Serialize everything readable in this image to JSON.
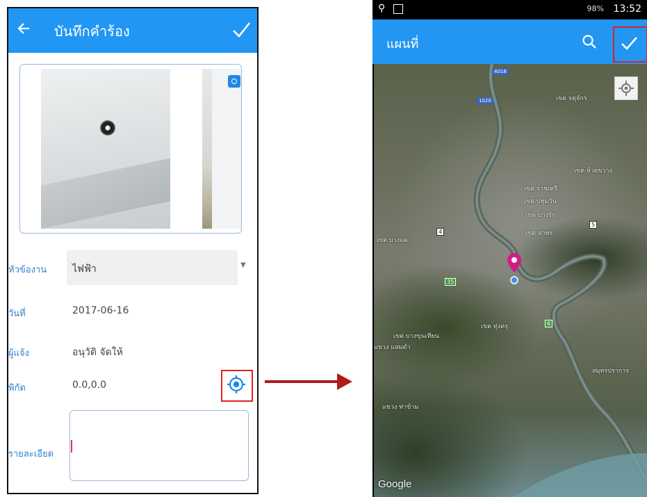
{
  "left_screen": {
    "title": "บันทึกคำร้อง",
    "back_icon": "arrow-left-icon",
    "confirm_icon": "check-icon",
    "camera_icon": "camera-icon",
    "fields": {
      "topic_label": "หัวข้องาน",
      "topic_value": "ไฟฟ้า",
      "date_label": "วันที่",
      "date_value": "2017-06-16",
      "reporter_label": "ผู้แจ้ง",
      "reporter_value": "อนุวัติ จัดให้",
      "coords_label": "พิกัด",
      "coords_value": "0.0,0.0",
      "detail_label": "รายละเอียด",
      "detail_value": ""
    },
    "location_icon": "gps-target-icon"
  },
  "right_screen": {
    "status_bar": {
      "battery": "98%",
      "time": "13:52"
    },
    "title": "แผนที่",
    "search_icon": "search-icon",
    "confirm_icon": "check-icon",
    "my_location_icon": "crosshair-icon",
    "map_labels": [
      "เขต จตุจักร",
      "เขต ห้วยขวาง",
      "เขต ราชเทวี",
      "เขต ปทุมวัน",
      "เขต บางรัก",
      "เขต สาทร",
      "เขต บางแค",
      "เขต บางขุนเทียน",
      "แขวง แสมดำ",
      "เขต ทุ่งครุ",
      "สมุทรปราการ",
      "แขวง ท่าข้าม"
    ],
    "road_shields": [
      "4018",
      "1020",
      "4",
      "5",
      "35",
      "6"
    ],
    "attribution": "Google"
  },
  "colors": {
    "app_bar": "#2196f3",
    "label_blue": "#2f7fd0",
    "highlight_red": "#e02020",
    "arrow_red": "#b01b1b",
    "pin_magenta": "#d6198a"
  }
}
